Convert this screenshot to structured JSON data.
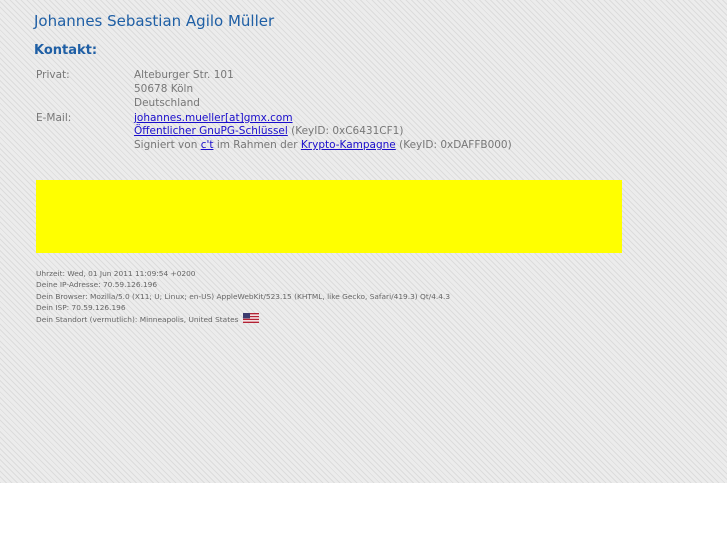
{
  "header": {
    "name": "Johannes Sebastian Agilo Müller",
    "contact_heading": "Kontakt:"
  },
  "contact": {
    "private_label": "Privat:",
    "address": {
      "street": "Alteburger Str. 101",
      "city": "50678 Köln",
      "country": "Deutschland"
    },
    "email_label": "E-Mail:",
    "email_link": "johannes.mueller[at]gmx.com",
    "gpg_link": "Öffentlicher GnuPG-Schlüssel",
    "gpg_keyid": "(KeyID: 0xC6431CF1)",
    "signed_prefix": "Signiert von",
    "signed_ct_link": "c't",
    "signed_middle": "im Rahmen der",
    "signed_campaign_link": "Krypto-Kampagne",
    "signed_keyid": "(KeyID: 0xDAFFB000)"
  },
  "banner": {
    "color": "#ffff00"
  },
  "visitor_info": {
    "time": "Uhrzeit: Wed, 01 Jun 2011 11:09:54 +0200",
    "ip": "Deine IP-Adresse: 70.59.126.196",
    "browser": "Dein Browser: Mozilla/5.0 (X11; U; Linux; en-US) AppleWebKit/523.15 (KHTML, like Gecko, Safari/419.3) Qt/4.4.3",
    "isp": "Dein ISP: 70.59.126.196",
    "location": "Dein Standort (vermutlich): Minneapolis, United States",
    "flag_icon": "us-flag-icon"
  },
  "colors": {
    "heading": "#1f5fa5",
    "link": "#1a0dcc",
    "text": "#777777"
  }
}
